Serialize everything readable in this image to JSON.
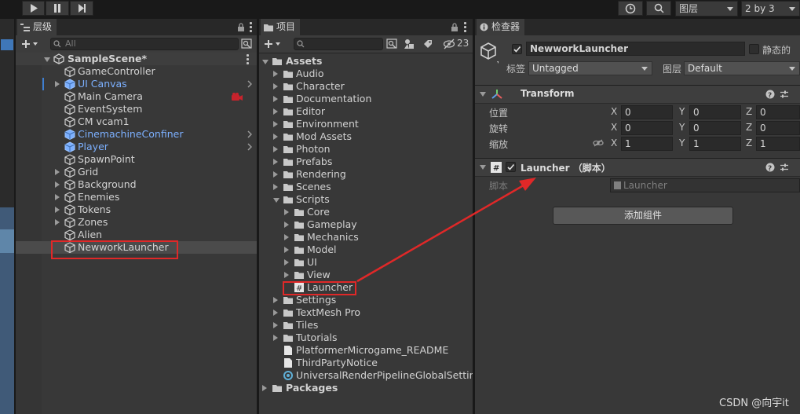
{
  "hierarchy": {
    "tab_label": "层级",
    "search_placeholder": "All",
    "scene_name": "SampleScene*",
    "items": [
      {
        "label": "GameController"
      },
      {
        "label": "UI Canvas"
      },
      {
        "label": "Main Camera"
      },
      {
        "label": "EventSystem"
      },
      {
        "label": "CM vcam1"
      },
      {
        "label": "CinemachineConfiner"
      },
      {
        "label": "Player"
      },
      {
        "label": "SpawnPoint"
      },
      {
        "label": "Grid"
      },
      {
        "label": "Background"
      },
      {
        "label": "Enemies"
      },
      {
        "label": "Tokens"
      },
      {
        "label": "Zones"
      },
      {
        "label": "Alien"
      },
      {
        "label": "NewworkLauncher"
      }
    ]
  },
  "project": {
    "tab_label": "项目",
    "hidden_count": "23",
    "tree": [
      {
        "label": "Assets"
      },
      {
        "label": "Audio"
      },
      {
        "label": "Character"
      },
      {
        "label": "Documentation"
      },
      {
        "label": "Editor"
      },
      {
        "label": "Environment"
      },
      {
        "label": "Mod Assets"
      },
      {
        "label": "Photon"
      },
      {
        "label": "Prefabs"
      },
      {
        "label": "Rendering"
      },
      {
        "label": "Scenes"
      },
      {
        "label": "Scripts"
      },
      {
        "label": "Core"
      },
      {
        "label": "Gameplay"
      },
      {
        "label": "Mechanics"
      },
      {
        "label": "Model"
      },
      {
        "label": "UI"
      },
      {
        "label": "View"
      },
      {
        "label": "Launcher"
      },
      {
        "label": "Settings"
      },
      {
        "label": "TextMesh Pro"
      },
      {
        "label": "Tiles"
      },
      {
        "label": "Tutorials"
      },
      {
        "label": "PlatformerMicrogame_README"
      },
      {
        "label": "ThirdPartyNotice"
      },
      {
        "label": "UniversalRenderPipelineGlobalSettings"
      },
      {
        "label": "Packages"
      }
    ]
  },
  "toolbar": {
    "layers_label": "图层",
    "layout_label": "2 by 3"
  },
  "inspector": {
    "tab_label": "检查器",
    "object_name": "NewworkLauncher",
    "static_label": "静态的",
    "tag_label": "标签",
    "tag_value": "Untagged",
    "layer_label": "图层",
    "layer_value": "Default",
    "transform": {
      "title": "Transform",
      "position_label": "位置",
      "rotation_label": "旋转",
      "scale_label": "缩放",
      "x_label": "X",
      "y_label": "Y",
      "z_label": "Z",
      "position": [
        "0",
        "0",
        "0"
      ],
      "rotation": [
        "0",
        "0",
        "0"
      ],
      "scale": [
        "1",
        "1",
        "1"
      ]
    },
    "script_component": {
      "title": "Launcher （脚本）",
      "script_label": "脚本",
      "script_value": "Launcher"
    },
    "add_component_label": "添加组件"
  },
  "watermark": "CSDN @向宇it",
  "colors": {
    "annotation_red": "#e02828",
    "prefab_blue": "#7cb0ff",
    "panel_bg": "#383838"
  }
}
